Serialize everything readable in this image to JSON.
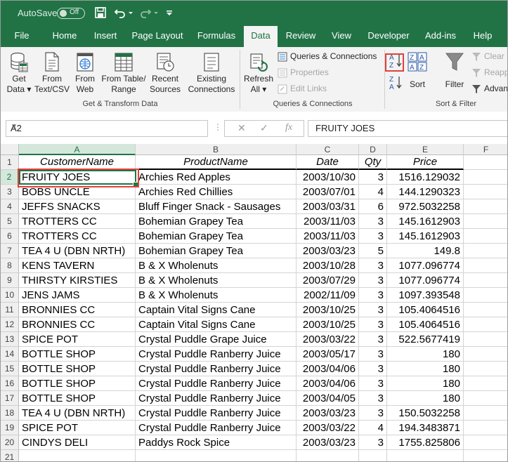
{
  "titlebar": {
    "autosave_label": "AutoSave",
    "autosave_state": "Off",
    "accent": "#217346"
  },
  "tabs": [
    "File",
    "Home",
    "Insert",
    "Page Layout",
    "Formulas",
    "Data",
    "Review",
    "View",
    "Developer",
    "Add-ins",
    "Help"
  ],
  "active_tab": "Data",
  "ribbon": {
    "get_data_1": "Get",
    "get_data_2": "Data ▾",
    "from_text_1": "From",
    "from_text_2": "Text/CSV",
    "from_web_1": "From",
    "from_web_2": "Web",
    "from_table_1": "From Table/",
    "from_table_2": "Range",
    "recent_1": "Recent",
    "recent_2": "Sources",
    "existing_1": "Existing",
    "existing_2": "Connections",
    "group_get": "Get & Transform Data",
    "refresh_1": "Refresh",
    "refresh_2": "All ▾",
    "queries": "Queries & Connections",
    "properties": "Properties",
    "edit_links": "Edit Links",
    "group_queries": "Queries & Connections",
    "sort": "Sort",
    "filter": "Filter",
    "clear": "Clear",
    "reapply": "Reapp",
    "advanced": "Advan",
    "group_sort": "Sort & Filter"
  },
  "formula_bar": {
    "name_box": "A2",
    "fx": "fx",
    "value": "FRUITY JOES"
  },
  "columns": [
    "A",
    "B",
    "C",
    "D",
    "E",
    "F"
  ],
  "header_row": [
    "CustomerName",
    "ProductName",
    "Date",
    "Qty",
    "Price"
  ],
  "row_numbers": [
    "1",
    "2",
    "3",
    "4",
    "5",
    "6",
    "7",
    "8",
    "9",
    "10",
    "11",
    "12",
    "13",
    "14",
    "15",
    "16",
    "17",
    "18",
    "19",
    "20",
    "21"
  ],
  "rows": [
    [
      "FRUITY JOES",
      "Archies Red Apples",
      "2003/10/30",
      "3",
      "1516.129032"
    ],
    [
      "BOBS UNCLE",
      "Archies Red Chillies",
      "2003/07/01",
      "4",
      "144.1290323"
    ],
    [
      "JEFFS SNACKS",
      "Bluff Finger Snack - Sausages",
      "2003/03/31",
      "6",
      "972.5032258"
    ],
    [
      "TROTTERS CC",
      "Bohemian Grapey Tea",
      "2003/11/03",
      "3",
      "145.1612903"
    ],
    [
      "TROTTERS CC",
      "Bohemian Grapey Tea",
      "2003/11/03",
      "3",
      "145.1612903"
    ],
    [
      "TEA 4 U (DBN NRTH)",
      "Bohemian Grapey Tea",
      "2003/03/23",
      "5",
      "149.8"
    ],
    [
      "KENS TAVERN",
      "B & X Wholenuts",
      "2003/10/28",
      "3",
      "1077.096774"
    ],
    [
      "THIRSTY KIRSTIES",
      "B & X Wholenuts",
      "2003/07/29",
      "3",
      "1077.096774"
    ],
    [
      "JENS JAMS",
      "B & X Wholenuts",
      "2002/11/09",
      "3",
      "1097.393548"
    ],
    [
      "BRONNIES  CC",
      "Captain Vital Signs Cane",
      "2003/10/25",
      "3",
      "105.4064516"
    ],
    [
      "BRONNIES  CC",
      "Captain Vital Signs Cane",
      "2003/10/25",
      "3",
      "105.4064516"
    ],
    [
      "SPICE POT",
      "Crystal Puddle Grape Juice",
      "2003/03/22",
      "3",
      "522.5677419"
    ],
    [
      "BOTTLE SHOP",
      "Crystal Puddle Ranberry Juice",
      "2003/05/17",
      "3",
      "180"
    ],
    [
      "BOTTLE SHOP",
      "Crystal Puddle Ranberry Juice",
      "2003/04/06",
      "3",
      "180"
    ],
    [
      "BOTTLE SHOP",
      "Crystal Puddle Ranberry Juice",
      "2003/04/06",
      "3",
      "180"
    ],
    [
      "BOTTLE SHOP",
      "Crystal Puddle Ranberry Juice",
      "2003/04/05",
      "3",
      "180"
    ],
    [
      "TEA 4 U (DBN NRTH)",
      "Crystal Puddle Ranberry Juice",
      "2003/03/23",
      "3",
      "150.5032258"
    ],
    [
      "SPICE POT",
      "Crystal Puddle Ranberry Juice",
      "2003/03/22",
      "4",
      "194.3483871"
    ],
    [
      "CINDYS DELI",
      "Paddys Rock Spice",
      "2003/03/23",
      "3",
      "1755.825806"
    ]
  ]
}
